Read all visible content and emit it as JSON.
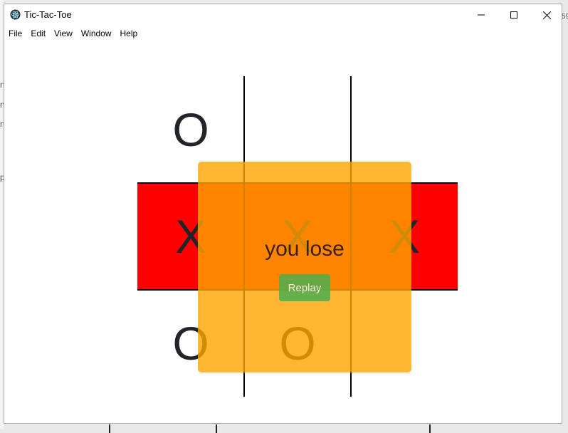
{
  "window": {
    "title": "Tic-Tac-Toe",
    "icon": "electron-atom-icon"
  },
  "menu": [
    "File",
    "Edit",
    "View",
    "Window",
    "Help"
  ],
  "background": {
    "fragments": [
      "n",
      "n",
      "n",
      "p",
      "59"
    ]
  },
  "board": {
    "cells": [
      "",
      "O",
      "",
      "X",
      "X",
      "X",
      "O",
      "O",
      ""
    ],
    "winning_row": 1,
    "winning_row_color": "#ff0000"
  },
  "overlay": {
    "message": "you lose",
    "replay_label": "Replay",
    "color": "#ffa500",
    "button_color": "#4caf50"
  }
}
